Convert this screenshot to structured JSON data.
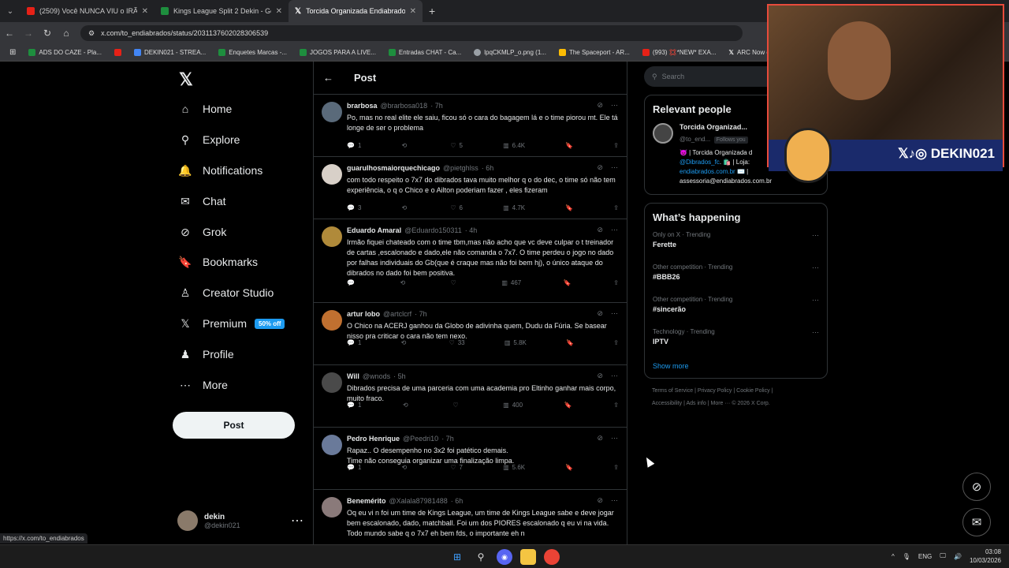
{
  "browser": {
    "tabs": [
      {
        "title": "(2509) Você NUNCA VIU o IRÃ",
        "color": "#e62117"
      },
      {
        "title": "Kings League Split 2 Dekin - Go",
        "color": "#1e8e3e"
      },
      {
        "title": "Torcida Organizada Endiabrado",
        "color": "#000000"
      }
    ],
    "url": "x.com/to_endiabrados/status/2031137602028306539",
    "bookmarks": [
      {
        "label": "ADS DO CAZE - Pla...",
        "color": "#1e8e3e"
      },
      {
        "label": "",
        "color": "#e62117"
      },
      {
        "label": "DEKIN021 - STREA...",
        "color": "#4285f4"
      },
      {
        "label": "Enquetes Marcas -...",
        "color": "#1e8e3e"
      },
      {
        "label": "JOGOS PARA A LIVE...",
        "color": "#1e8e3e"
      },
      {
        "label": "Entradas CHAT - Ca...",
        "color": "#1e8e3e"
      },
      {
        "label": "lpqCKMLP_o.png (1...",
        "color": "#9aa0a6"
      },
      {
        "label": "The Spaceport - AR...",
        "color": "#fbbc04"
      },
      {
        "label": "(993) 💢*NEW* EXA...",
        "color": "#e62117"
      },
      {
        "label": "ARC Now on X: \"Co...",
        "color": "#000000"
      }
    ],
    "status_url": "https://x.com/to_endiabrados"
  },
  "nav": {
    "items": [
      {
        "label": "Home",
        "icon": "⌂"
      },
      {
        "label": "Explore",
        "icon": "⚲"
      },
      {
        "label": "Notifications",
        "icon": "🔔"
      },
      {
        "label": "Chat",
        "icon": "✉"
      },
      {
        "label": "Grok",
        "icon": "⊘"
      },
      {
        "label": "Bookmarks",
        "icon": "🔖"
      },
      {
        "label": "Creator Studio",
        "icon": "♙"
      },
      {
        "label": "Premium",
        "icon": "𝕏"
      },
      {
        "label": "Profile",
        "icon": "♟"
      },
      {
        "label": "More",
        "icon": "⋯"
      }
    ],
    "premium_badge": "50% off",
    "post_button": "Post",
    "user": {
      "name": "dekin",
      "handle": "@dekin021"
    }
  },
  "main": {
    "title": "Post",
    "tweets": [
      {
        "name": "brarbosa",
        "handle": "@brarbosa018",
        "time": "· 7h",
        "text": "Po, mas no real elite ele saiu, ficou só o cara do bagagem lá e o time piorou mt. Ele tá longe de ser o problema",
        "replies": "1",
        "retweets": "",
        "likes": "5",
        "views": "6.4K",
        "avatar": "#5a6a7a"
      },
      {
        "name": "guarulhosmaiorquechicago",
        "handle": "@pietghlss",
        "time": "· 6h",
        "text": "com todo respeito o 7x7 do dibrados tava muito melhor q o do dec, o time só não tem experiência, o q o Chico e o Ailton poderiam fazer , eles fizeram",
        "replies": "3",
        "retweets": "",
        "likes": "6",
        "views": "4.7K",
        "avatar": "#d8d0c8"
      },
      {
        "name": "Eduardo Amaral",
        "handle": "@Eduardo150311",
        "time": "· 4h",
        "text": "Irmão fiquei chateado com o time tbm,mas não acho que vc deve culpar o t treinador de cartas ,escalonado e dado,ele não comanda o 7x7. O time perdeu o jogo no dado por falhas individuais do Gb(que é craque mas não foi bem hj), o único ataque do dibrados no dado foi bem positiva.",
        "replies": "",
        "retweets": "",
        "likes": "",
        "views": "467",
        "avatar": "#b08a3a"
      },
      {
        "name": "artur lobo",
        "handle": "@artclcrf",
        "time": "· 7h",
        "text": "O Chico na ACERJ ganhou da Globo de adivinha quem, Dudu da Fúria. Se basear nisso pra criticar o cara não tem nexo.",
        "replies": "1",
        "retweets": "",
        "likes": "33",
        "views": "5.8K",
        "avatar": "#c07030"
      },
      {
        "name": "Will",
        "handle": "@wnods",
        "time": "· 5h",
        "text": "Dibrados precisa de uma parceria com uma academia pro Eltinho ganhar mais corpo, muito fraco.",
        "replies": "1",
        "retweets": "",
        "likes": "",
        "views": "400",
        "avatar": "#4a4a4a"
      },
      {
        "name": "Pedro Henrique",
        "handle": "@Peedri10",
        "time": "· 7h",
        "text": "Rapaz.. O desempenho no 3x2 foi patético demais.\nTime não conseguia organizar uma finalização limpa.",
        "replies": "1",
        "retweets": "",
        "likes": "7",
        "views": "5.6K",
        "avatar": "#6a7a9a"
      },
      {
        "name": "Benemérito",
        "handle": "@Xalala87981488",
        "time": "· 6h",
        "text": "Oq eu vi n foi um time de Kings League, um time de Kings League sabe e deve jogar bem escalonado, dado, matchball. Foi um dos PIORES escalonado q eu vi na vida. Todo mundo sabe q o 7x7 eh bem fds, o importante eh n",
        "replies": "",
        "retweets": "",
        "likes": "",
        "views": "",
        "avatar": "#8a7a7a"
      }
    ]
  },
  "sidebar": {
    "search_placeholder": "Search",
    "relevant": {
      "title": "Relevant people",
      "name": "Torcida Organizad...",
      "handle": "@to_end...",
      "follows": "Follows you",
      "bio_1": "😈 | Torcida Organizada d",
      "bio_mention": "@Dibrados_fc",
      "bio_2": ". 🛍️ | Loja:",
      "bio_link": "endiabrados.com.br",
      "bio_3": " ✉️ |",
      "bio_4": "assessoria@endiabrados.com.br"
    },
    "happening": {
      "title": "What’s happening",
      "trends": [
        {
          "meta": "Only on X · Trending",
          "name": "Ferette"
        },
        {
          "meta": "Other competition · Trending",
          "name": "#BBB26"
        },
        {
          "meta": "Other competition · Trending",
          "name": "#sincerão"
        },
        {
          "meta": "Technology · Trending",
          "name": "IPTV"
        }
      ],
      "show_more": "Show more"
    },
    "footer": [
      "Terms of Service",
      "|",
      "Privacy Policy",
      "|",
      "Cookie Policy",
      "|",
      "Accessibility",
      "|",
      "Ads info",
      "|",
      "More ···",
      "© 2026 X Corp."
    ]
  },
  "overlay": {
    "brand": "𝕏♪◎ DEKIN021"
  },
  "taskbar": {
    "lang": "ENG",
    "time": "03:08",
    "date": "10/03/2026"
  }
}
